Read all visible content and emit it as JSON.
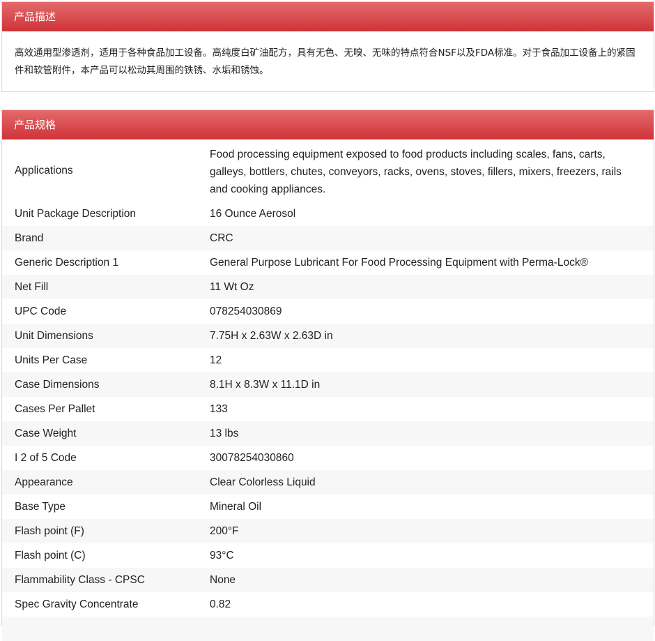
{
  "description": {
    "header": "产品描述",
    "text": "高效通用型渗透剂，适用于各种食品加工设备。高纯度白矿油配方，具有无色、无嗅、无味的特点符合NSF以及FDA标准。对于食品加工设备上的紧固件和软管附件，本产品可以松动其周围的铁锈、水垢和锈蚀。"
  },
  "specs": {
    "header": "产品规格",
    "rows": [
      {
        "label": "Applications",
        "value": "Food processing equipment exposed to food products including scales, fans, carts, galleys, bottlers, chutes, conveyors, racks, ovens, stoves, fillers, mixers, freezers, rails and cooking appliances."
      },
      {
        "label": "Unit Package Description",
        "value": "16 Ounce Aerosol"
      },
      {
        "label": "Brand",
        "value": "CRC"
      },
      {
        "label": "Generic Description 1",
        "value": "General Purpose Lubricant For Food Processing Equipment with Perma-Lock®"
      },
      {
        "label": "Net Fill",
        "value": "11 Wt Oz"
      },
      {
        "label": "UPC Code",
        "value": "078254030869"
      },
      {
        "label": "Unit Dimensions",
        "value": "7.75H x 2.63W x 2.63D in"
      },
      {
        "label": "Units Per Case",
        "value": "12"
      },
      {
        "label": "Case Dimensions",
        "value": "8.1H x 8.3W x 11.1D in"
      },
      {
        "label": "Cases Per Pallet",
        "value": "133"
      },
      {
        "label": "Case Weight",
        "value": "13 lbs"
      },
      {
        "label": "I 2 of 5 Code",
        "value": "30078254030860"
      },
      {
        "label": "Appearance",
        "value": "Clear Colorless Liquid"
      },
      {
        "label": "Base Type",
        "value": "Mineral Oil"
      },
      {
        "label": "Flash point (F)",
        "value": "200°F"
      },
      {
        "label": "Flash point (C)",
        "value": "93°C"
      },
      {
        "label": "Flammability Class - CPSC",
        "value": "None"
      },
      {
        "label": "Spec Gravity Concentrate",
        "value": "0.82"
      }
    ]
  },
  "colors": {
    "header_top": "#e46a6c",
    "header_bottom": "#cf3337",
    "row_alt": "#f7f7f7"
  }
}
